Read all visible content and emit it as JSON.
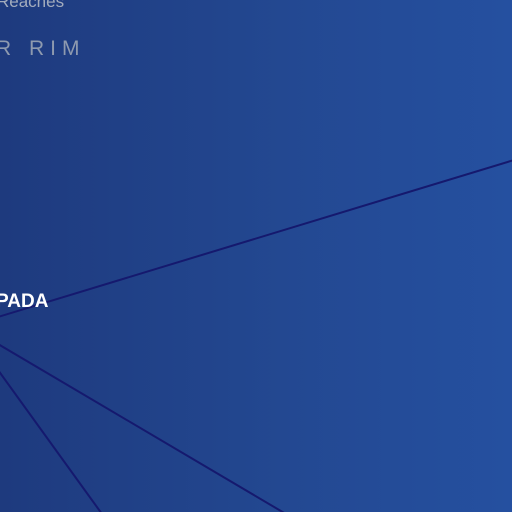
{
  "map": {
    "region_labels": {
      "top_partial": "Reaches",
      "rim_partial": "R RIM"
    },
    "system_label": "PADA",
    "colors": {
      "background_left": "#1e3a7e",
      "background_right": "#2550a0",
      "route_line": "#15196e",
      "system_label": "#ffffff",
      "region_label": "#a3acbd"
    }
  }
}
